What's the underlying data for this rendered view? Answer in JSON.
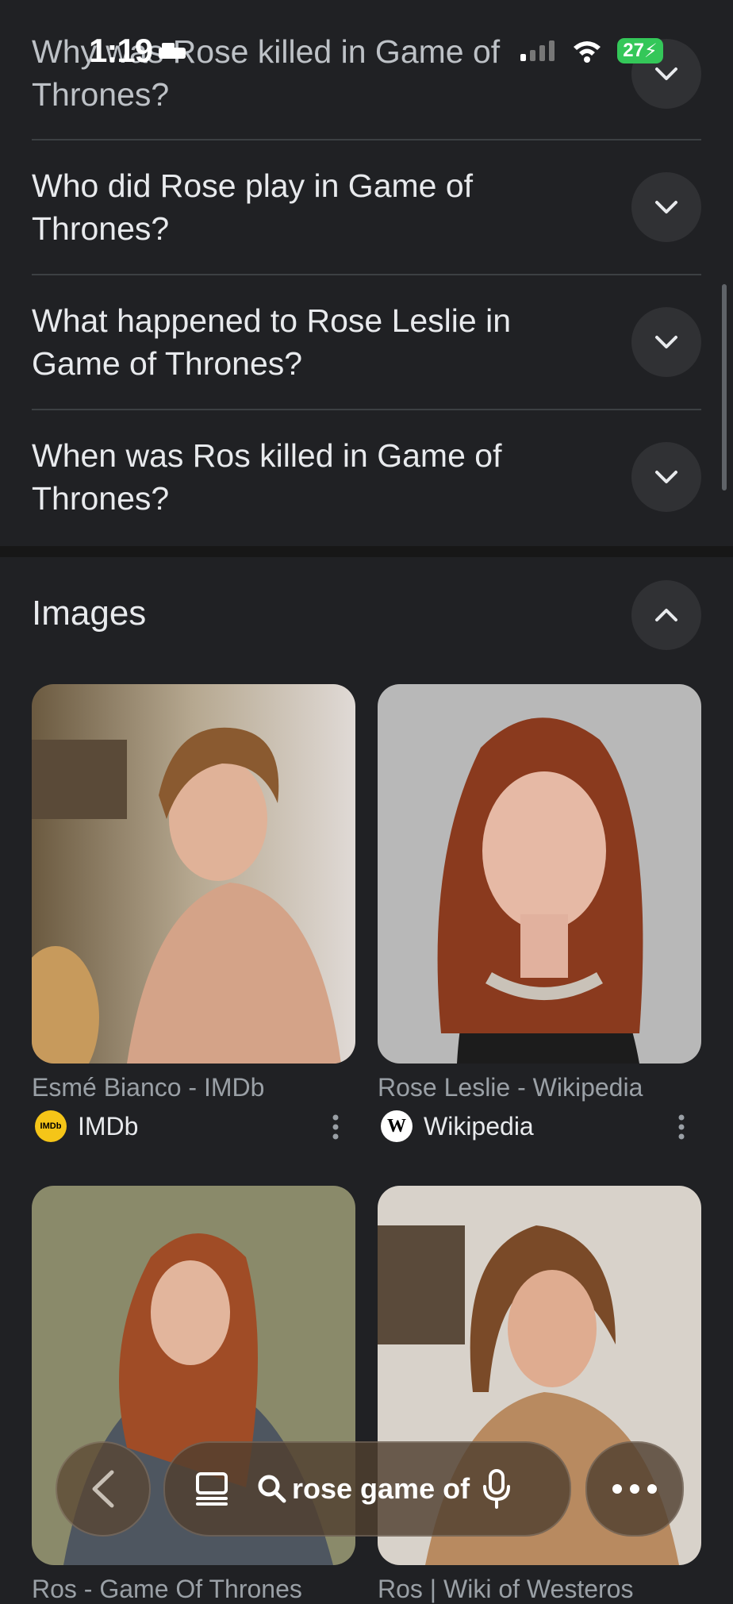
{
  "status_bar": {
    "time": "1:19",
    "battery": "27"
  },
  "faq": [
    {
      "question": "Why was Rose killed in Game of Thrones?"
    },
    {
      "question": "Who did Rose play in Game of Thrones?"
    },
    {
      "question": "What happened to Rose Leslie in Game of Thrones?"
    },
    {
      "question": "When was Ros killed in Game of Thrones?"
    }
  ],
  "images_section": {
    "title": "Images",
    "results": [
      {
        "title": "Esmé Bianco - IMDb",
        "source": "IMDb",
        "logo_text": "IMDb"
      },
      {
        "title": "Rose Leslie - Wikipedia",
        "source": "Wikipedia",
        "logo_text": "W"
      },
      {
        "title": "Ros - Game Of Thrones",
        "source": ""
      },
      {
        "title": "Ros | Wiki of Westeros",
        "source": ""
      }
    ]
  },
  "bottom_bar": {
    "query": "rose game of"
  },
  "colors": {
    "background": "#202124",
    "imdb_yellow": "#f5c518",
    "battery_green": "#34c759"
  }
}
